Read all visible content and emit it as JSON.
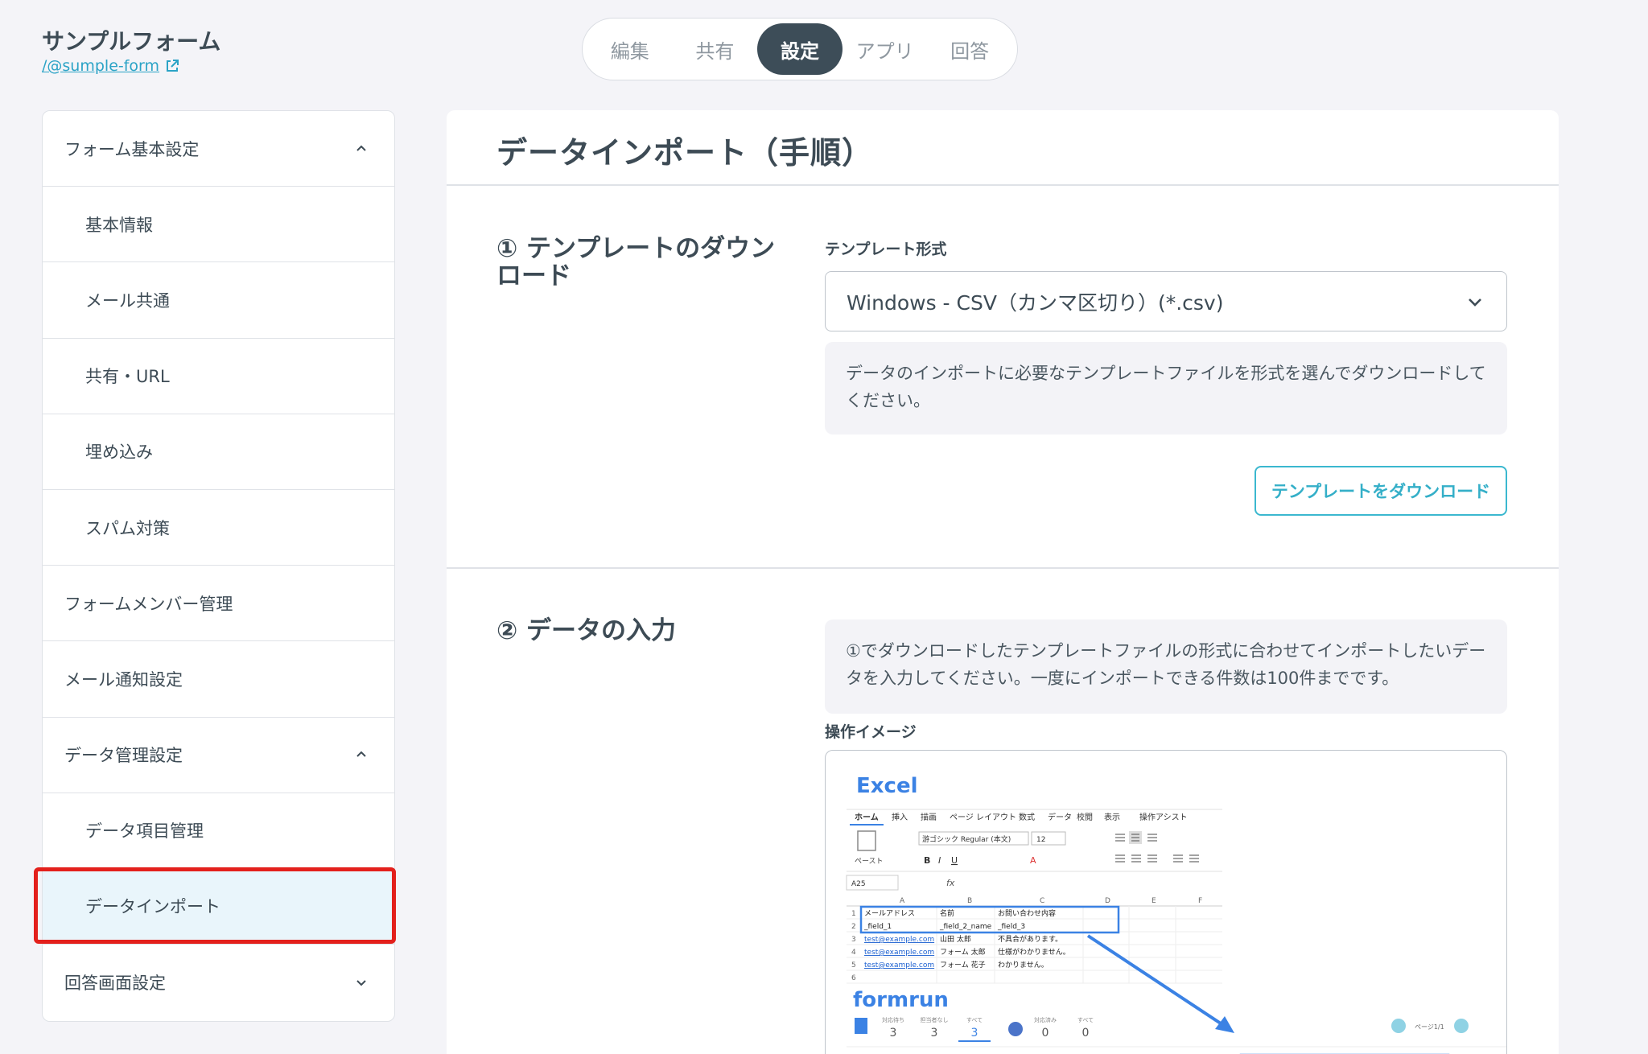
{
  "header": {
    "form_title": "サンプルフォーム",
    "form_link": "/@sumple-form"
  },
  "tabs": [
    {
      "label": "編集",
      "active": false
    },
    {
      "label": "共有",
      "active": false
    },
    {
      "label": "設定",
      "active": true
    },
    {
      "label": "アプリ",
      "active": false
    },
    {
      "label": "回答",
      "active": false
    }
  ],
  "sidebar": {
    "items": [
      {
        "label": "フォーム基本設定",
        "expand": "up"
      },
      {
        "label": "基本情報"
      },
      {
        "label": "メール共通"
      },
      {
        "label": "共有・URL"
      },
      {
        "label": "埋め込み"
      },
      {
        "label": "スパム対策"
      },
      {
        "label": "フォームメンバー管理"
      },
      {
        "label": "メール通知設定"
      },
      {
        "label": "データ管理設定",
        "expand": "up"
      },
      {
        "label": "データ項目管理"
      },
      {
        "label": "データインポート",
        "active": true
      },
      {
        "label": "回答画面設定",
        "expand": "down"
      }
    ]
  },
  "main": {
    "title": "データインポート（手順）",
    "step1": {
      "title": "① テンプレートのダウンロード",
      "format_label": "テンプレート形式",
      "format_value": "Windows - CSV（カンマ区切り）(*.csv)",
      "note": "データのインポートに必要なテンプレートファイルを形式を選んでダウンロードしてください。",
      "download_button": "テンプレートをダウンロード"
    },
    "step2": {
      "title": "② データの入力",
      "note": "①でダウンロードしたテンプレートファイルの形式に合わせてインポートしたいデータを入力してください。一度にインポートできる件数は100件までです。",
      "image_label": "操作イメージ"
    }
  },
  "excel_preview": {
    "app_name": "Excel",
    "ribbon_tabs": [
      "ホーム",
      "挿入",
      "描画",
      "ページ レイアウト",
      "数式",
      "データ",
      "校閲",
      "表示",
      "操作アシスト"
    ],
    "font_name": "游ゴシック Regular (本文)",
    "font_size": "12",
    "paste_label": "ペースト",
    "cell_ref": "A25",
    "columns": [
      "A",
      "B",
      "C",
      "D",
      "E",
      "F"
    ],
    "row_numbers": [
      "1",
      "2",
      "3",
      "4",
      "5",
      "6"
    ],
    "rows": [
      [
        "メールアドレス",
        "名前",
        "お問い合わせ内容"
      ],
      [
        "_field_1",
        "_field_2_name",
        "_field_3"
      ],
      [
        "test@example.com",
        "山田 太郎",
        "不具合があります。"
      ],
      [
        "test@example.com",
        "フォーム 太郎",
        "仕様がわかりません。"
      ],
      [
        "test@example.com",
        "フォーム 花子",
        "わかりません。"
      ]
    ]
  },
  "formrun_preview": {
    "app_name": "formrun",
    "stats": [
      {
        "label": "対応待ち",
        "value": "3"
      },
      {
        "label": "担当者なし",
        "value": "3"
      },
      {
        "label": "すべて",
        "value": "3"
      },
      {
        "label": "対応済み",
        "value": "0"
      },
      {
        "label": "すべて",
        "value": "0"
      }
    ],
    "page_indicator": "ページ1/1"
  },
  "colors": {
    "accent": "#34afc8",
    "tab_active": "#3d4d58",
    "highlight": "#e3201c"
  }
}
